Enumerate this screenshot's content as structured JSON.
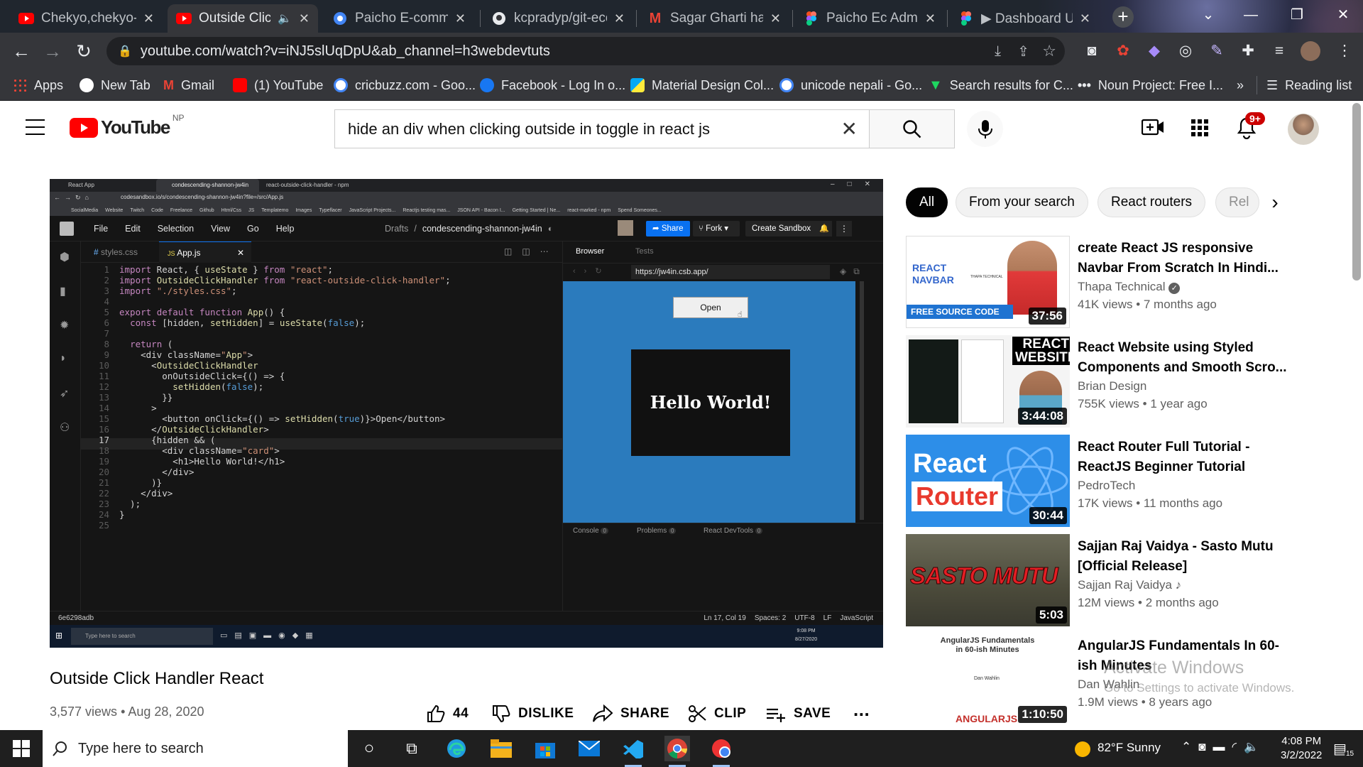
{
  "browser": {
    "tabs": [
      {
        "label": "Chekyo,chekyo- N",
        "icon": "youtube-icon",
        "active": false
      },
      {
        "label": "Outside Click",
        "icon": "youtube-icon",
        "active": true
      },
      {
        "label": "Paicho E-comme",
        "icon": "chrome-icon",
        "active": false
      },
      {
        "label": "kcpradyp/git-eco",
        "icon": "github-icon",
        "active": false
      },
      {
        "label": "Sagar Gharti has",
        "icon": "gmail-icon",
        "active": false
      },
      {
        "label": "Paicho Ec Admin",
        "icon": "figma-icon",
        "active": false
      },
      {
        "label": "▶ Dashboard U",
        "icon": "figma-icon",
        "active": false
      }
    ],
    "url": "youtube.com/watch?v=iNJ5slUqDpU&ab_channel=h3webdevtuts",
    "bookmarks": [
      {
        "label": "Apps"
      },
      {
        "label": "New Tab"
      },
      {
        "label": "Gmail"
      },
      {
        "label": "(1) YouTube"
      },
      {
        "label": "cricbuzz.com - Goo..."
      },
      {
        "label": "Facebook - Log In o..."
      },
      {
        "label": "Material Design Col..."
      },
      {
        "label": "unicode nepali - Go..."
      },
      {
        "label": "Search results for C..."
      },
      {
        "label": "Noun Project: Free I..."
      }
    ],
    "reading_list": "Reading list",
    "more_bookmarks": "»"
  },
  "youtube": {
    "logo_text": "YouTube",
    "country": "NP",
    "search_query": "hide an div when clicking outside in toggle in react js",
    "notification_count": "9+"
  },
  "video": {
    "title": "Outside Click Handler React",
    "views": "3,577 views",
    "date": "Aug 28, 2020",
    "likes": "44",
    "dislike_label": "DISLIKE",
    "share_label": "SHARE",
    "clip_label": "CLIP",
    "save_label": "SAVE",
    "more": "..."
  },
  "frame": {
    "tabs": [
      "React App",
      "condescending-shannon-jw4in",
      "react-outside-click-handler - npm"
    ],
    "url": "codesandbox.io/s/condescending-shannon-jw4in?file=/src/App.js",
    "bookmarks": [
      "SocialMedia",
      "Website",
      "Twitch",
      "Code",
      "Freelance",
      "Github",
      "Html/Css",
      "JS",
      "Templatemo",
      "Images",
      "Typeflacer",
      "JavaScript Projects...",
      "Reactjs testing mas...",
      "JSON API - Bacon I...",
      "Getting Started | Ne...",
      "react-marked - npm",
      "Spend Someones..."
    ],
    "menu": [
      "File",
      "Edit",
      "Selection",
      "View",
      "Go",
      "Help"
    ],
    "breadcrumb_drafts": "Drafts",
    "breadcrumb_sep": "/",
    "project": "condescending-shannon-jw4in",
    "share": "Share",
    "fork": "Fork",
    "create_sandbox": "Create Sandbox",
    "file_tabs": [
      "styles.css",
      "App.js"
    ],
    "file_tab_prefix": "JS",
    "file_tab_hash": "#",
    "panel_tabs": [
      "Browser",
      "Tests"
    ],
    "preview_url": "https://jw4in.csb.app/",
    "open_button": "Open",
    "hello": "Hello World!",
    "console_tabs": [
      "Console",
      "Problems",
      "React DevTools"
    ],
    "console_counts": [
      "0",
      "0",
      "0"
    ],
    "status_left": "6e6298adb",
    "status_right": [
      "Ln 17, Col 19",
      "Spaces: 2",
      "UTF-8",
      "LF",
      "JavaScript"
    ],
    "win_search": "Type here to search",
    "win_time": "9:08 PM",
    "win_date": "8/27/2020",
    "line_numbers": [
      "1",
      "2",
      "3",
      "4",
      "5",
      "6",
      "7",
      "8",
      "9",
      "10",
      "11",
      "12",
      "13",
      "14",
      "15",
      "16",
      "17",
      "18",
      "19",
      "20",
      "21",
      "22",
      "23",
      "24",
      "25"
    ],
    "code_lines": [
      "import React, { useState } from \"react\";",
      "import OutsideClickHandler from \"react-outside-click-handler\";",
      "import \"./styles.css\";",
      "",
      "export default function App() {",
      "  const [hidden, setHidden] = useState(false);",
      "",
      "  return (",
      "    <div className=\"App\">",
      "      <OutsideClickHandler",
      "        onOutsideClick={() => {",
      "          setHidden(false);",
      "        }}",
      "      >",
      "        <button onClick={() => setHidden(true)}>Open</button>",
      "      </OutsideClickHandler>",
      "      {hidden && (",
      "        <div className=\"card\">",
      "          <h1>Hello World!</h1>",
      "        </div>",
      "      )}",
      "    </div>",
      "  );",
      "}",
      ""
    ]
  },
  "sidebar": {
    "chips": [
      "All",
      "From your search",
      "React routers",
      "Rel"
    ],
    "recommendations": [
      {
        "title": "create React JS responsive Navbar From Scratch In Hindi...",
        "channel": "Thapa Technical",
        "verified": true,
        "meta": "41K views • 7 months ago",
        "duration": "37:56",
        "thumb_text": [
          "REACT",
          "NAVBAR",
          "FREE SOURCE CODE",
          "THAPA TECHNICAL"
        ]
      },
      {
        "title": "React Website using Styled Components and Smooth Scro...",
        "channel": "Brian Design",
        "verified": false,
        "meta": "755K views • 1 year ago",
        "duration": "3:44:08",
        "thumb_text": [
          "REACT",
          "WEBSITE"
        ]
      },
      {
        "title": "React Router Full Tutorial - ReactJS Beginner Tutorial",
        "channel": "PedroTech",
        "verified": false,
        "meta": "17K views • 11 months ago",
        "duration": "30:44",
        "thumb_text": [
          "React",
          "Router"
        ]
      },
      {
        "title": "Sajjan Raj Vaidya - Sasto Mutu [Official Release]",
        "channel": "Sajjan Raj Vaidya",
        "verified": false,
        "music": true,
        "meta": "12M views • 2 months ago",
        "duration": "5:03",
        "thumb_text": [
          "SASTO MUTU"
        ]
      },
      {
        "title": "AngularJS Fundamentals In 60-ish Minutes",
        "channel": "Dan Wahlin",
        "verified": false,
        "meta": "1.9M views • 8 years ago",
        "duration": "1:10:50",
        "thumb_text": [
          "AngularJS Fundamentals",
          "in 60-ish Minutes",
          "Dan Wahlin",
          "ANGULARJS"
        ]
      }
    ]
  },
  "watermark": {
    "line1": "Activate Windows",
    "line2": "Go to Settings to activate Windows."
  },
  "taskbar": {
    "search_placeholder": "Type here to search",
    "weather": "82°F  Sunny",
    "time": "4:08 PM",
    "date": "3/2/2022",
    "notif": "15"
  },
  "colors": {
    "youtube_red": "#ff0000",
    "codesandbox_bg": "#151515",
    "preview_blue": "#2b7bbd",
    "share_blue": "#0971f1"
  }
}
